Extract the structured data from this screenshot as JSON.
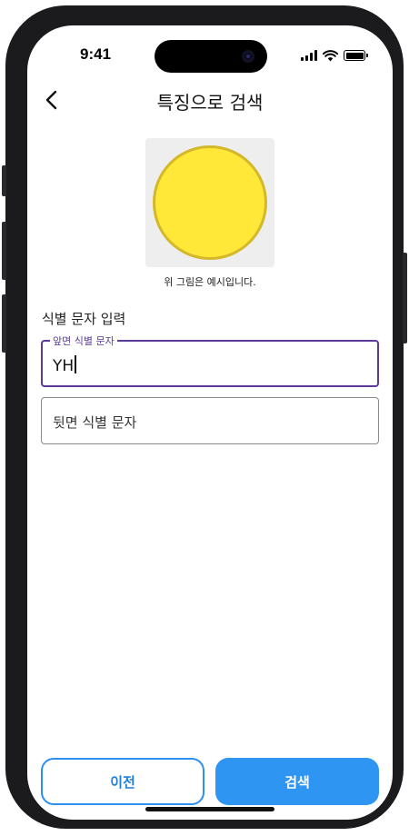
{
  "status_bar": {
    "time": "9:41",
    "icons": [
      "cellular-signal-icon",
      "wifi-icon",
      "battery-icon"
    ]
  },
  "header": {
    "title": "특징으로 검색",
    "back_icon": "chevron-left-icon"
  },
  "example": {
    "caption": "위 그림은 예시입니다.",
    "pill_color": "#ffe838",
    "pill_border_color": "#d4b82a"
  },
  "form": {
    "section_label": "식별 문자 입력",
    "front_field": {
      "label": "앞면 식별 문자",
      "value": "YH"
    },
    "back_field": {
      "placeholder": "뒷면 식별 문자",
      "value": ""
    }
  },
  "buttons": {
    "prev_label": "이전",
    "search_label": "검색"
  },
  "colors": {
    "accent": "#2e96f2",
    "focus": "#5b3a9a"
  }
}
